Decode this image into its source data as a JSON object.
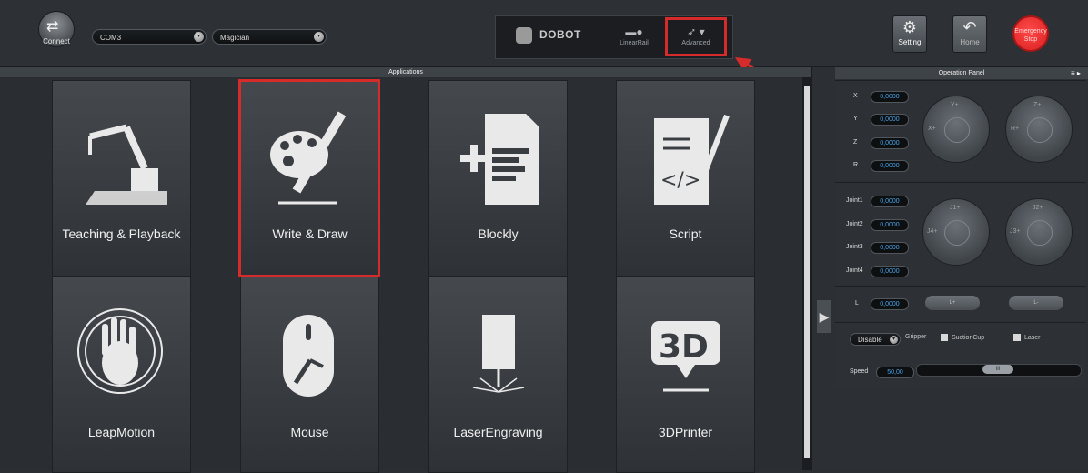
{
  "toolbar": {
    "connect_label": "Connect",
    "port_value": "COM3",
    "device_value": "Magician",
    "logo_text": "DOBOT",
    "linearrail_label": "LinearRail",
    "advanced_label": "Advanced",
    "setting_label": "Setting",
    "home_label": "Home",
    "estop_label_1": "Emergency",
    "estop_label_2": "Stop"
  },
  "apps": {
    "header": "Applications",
    "tiles": [
      {
        "label": "Teaching & Playback",
        "icon": "robot-arm-icon"
      },
      {
        "label": "Write & Draw",
        "icon": "palette-pencil-icon"
      },
      {
        "label": "Blockly",
        "icon": "blockly-document-icon"
      },
      {
        "label": "Script",
        "icon": "script-code-icon"
      },
      {
        "label": "LeapMotion",
        "icon": "hand-icon"
      },
      {
        "label": "Mouse",
        "icon": "mouse-icon"
      },
      {
        "label": "LaserEngraving",
        "icon": "laser-icon"
      },
      {
        "label": "3DPrinter",
        "icon": "3d-print-icon"
      }
    ]
  },
  "panel": {
    "title": "Operation Panel",
    "coords": [
      {
        "label": "X",
        "value": "0,0000"
      },
      {
        "label": "Y",
        "value": "0,0000"
      },
      {
        "label": "Z",
        "value": "0,0000"
      },
      {
        "label": "R",
        "value": "0,0000"
      }
    ],
    "joints": [
      {
        "label": "Joint1",
        "value": "0,0000"
      },
      {
        "label": "Joint2",
        "value": "0,0000"
      },
      {
        "label": "Joint3",
        "value": "0,0000"
      },
      {
        "label": "Joint4",
        "value": "0,0000"
      }
    ],
    "rail": {
      "label": "L",
      "value": "0,0000",
      "plus": "L+",
      "minus": "L-"
    },
    "joy_xy": {
      "top": "Y+",
      "left": "X+"
    },
    "joy_zr": {
      "top": "Z+",
      "left": "R+"
    },
    "joy_j14": {
      "top": "J1+",
      "left": "J4+"
    },
    "joy_j23": {
      "top": "J2+",
      "left": "J3+"
    },
    "end_effector": {
      "mode": "Disable",
      "gripper": "Gripper",
      "suction": "SuctionCup",
      "laser": "Laser"
    },
    "speed": {
      "label": "Speed",
      "value": "50,00",
      "thumb": "III"
    }
  },
  "colors": {
    "accent": "#d62b2b",
    "value_text": "#4aa3e8"
  }
}
